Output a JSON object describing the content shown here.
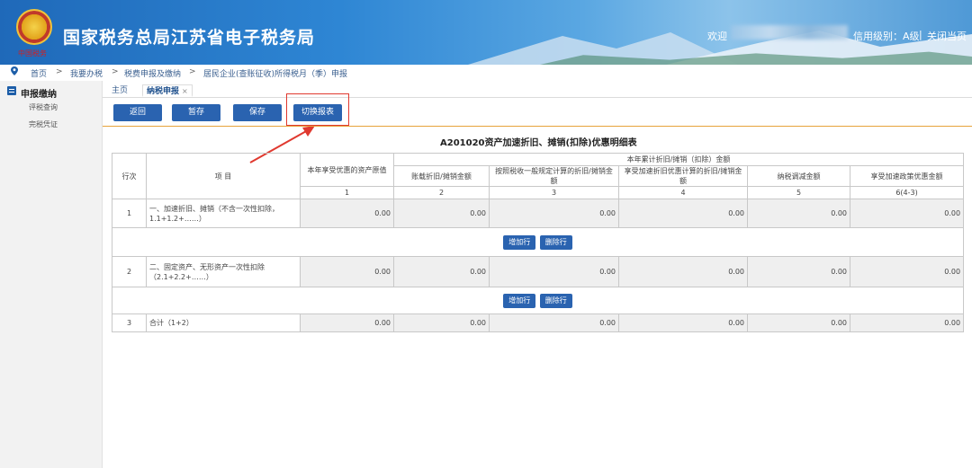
{
  "header": {
    "site_title": "国家税务总局江苏省电子税务局",
    "logo_text": "中国税务",
    "welcome": "欢迎",
    "credit_level": "信用级别：A级",
    "separator": "|",
    "close_home": "关闭当页"
  },
  "breadcrumb": {
    "items": [
      "首页",
      "我要办税",
      "税费申报及缴纳",
      "居民企业(查账征收)所得税月（季）申报"
    ],
    "separator": ">"
  },
  "sidebar": {
    "title": "申报缴纳",
    "items": [
      "评税查询",
      "完税凭证"
    ]
  },
  "tabs": {
    "home": "主页",
    "active": "纳税申报",
    "close": "×"
  },
  "toolbar": {
    "back": "返回",
    "temp_save": "暂存",
    "save": "保存",
    "switch": "切换报表"
  },
  "form": {
    "title": "A201020资产加速折旧、摊销(扣除)优惠明细表",
    "headers": {
      "row_no": "行次",
      "item": "项  目",
      "col1_title": "本年享受优惠的资产原值",
      "group_title": "本年累计折旧/摊销（扣除）金额",
      "col2_title": "账载折旧/摊销金额",
      "col3_title": "按照税收一般规定计算的折旧/摊销金额",
      "col4_title": "享受加速折旧优惠计算的折旧/摊销金额",
      "col5_title": "纳税调减金额",
      "col6_title": "享受加速政策优惠金额"
    },
    "col_numbers": [
      "1",
      "2",
      "3",
      "4",
      "5",
      "6(4-3)"
    ],
    "rows": [
      {
        "no": "1",
        "item": "一、加速折旧、摊销（不含一次性扣除，1.1+1.2+……）",
        "values": [
          "0.00",
          "0.00",
          "0.00",
          "0.00",
          "0.00",
          "0.00"
        ]
      },
      {
        "no": "2",
        "item": "二、固定资产、无形资产一次性扣除（2.1+2.2+……）",
        "values": [
          "0.00",
          "0.00",
          "0.00",
          "0.00",
          "0.00",
          "0.00"
        ]
      },
      {
        "no": "3",
        "item": "合计（1+2）",
        "values": [
          "0.00",
          "0.00",
          "0.00",
          "0.00",
          "0.00",
          "0.00"
        ]
      }
    ],
    "add_row": "增加行",
    "delete_row": "删除行"
  }
}
